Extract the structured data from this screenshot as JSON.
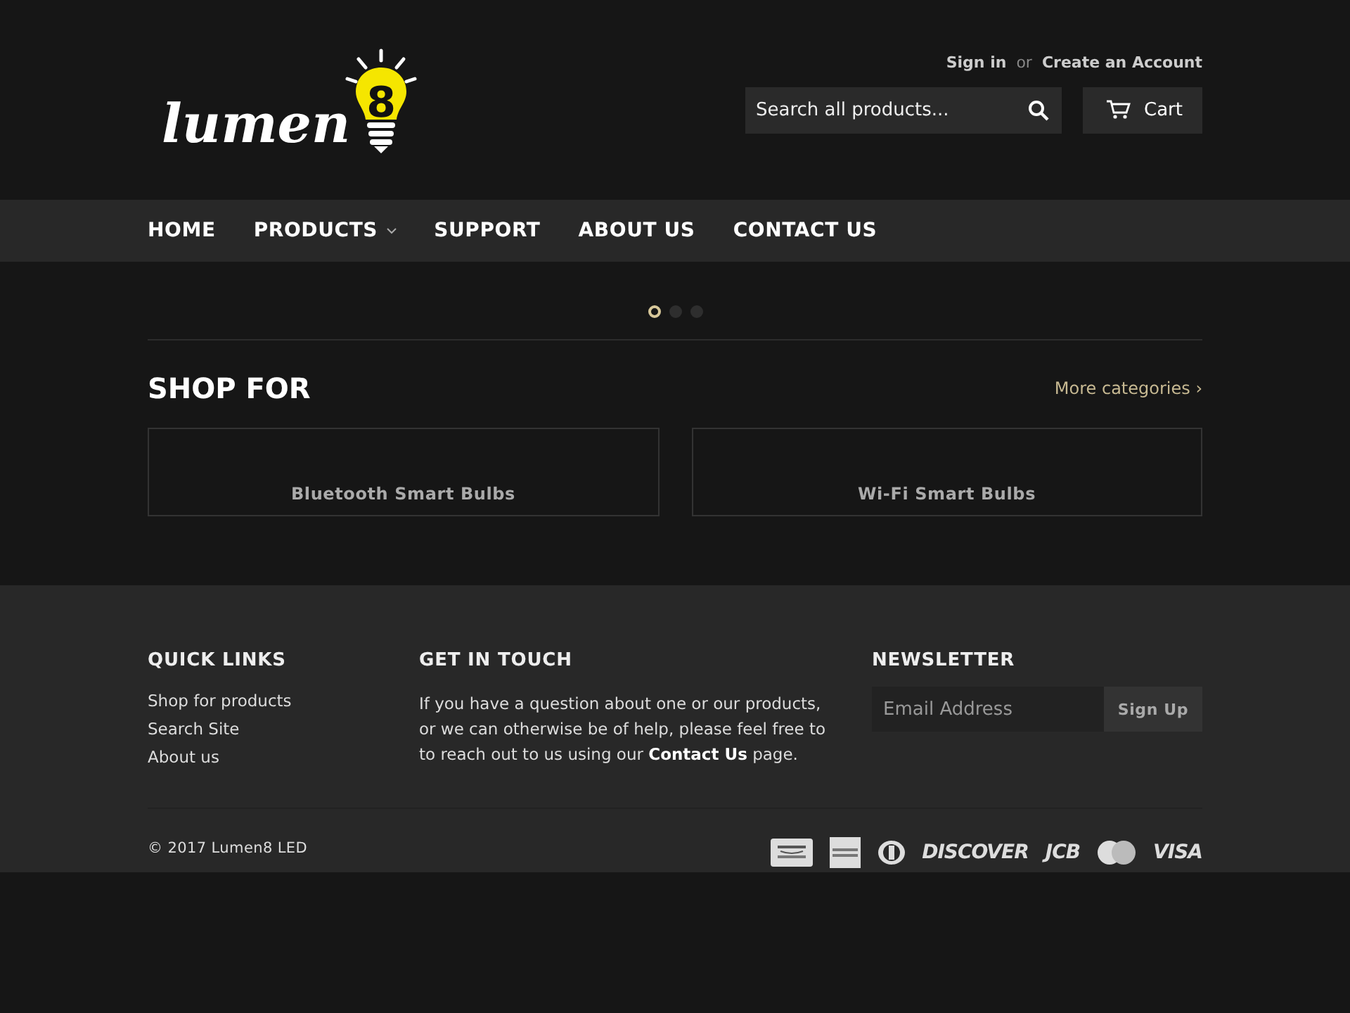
{
  "logo": {
    "text": "lumen",
    "digit": "8"
  },
  "account": {
    "sign_in": "Sign in",
    "separator": "or",
    "create": "Create an Account"
  },
  "search": {
    "placeholder": "Search all products..."
  },
  "cart": {
    "label": "Cart"
  },
  "nav": [
    {
      "label": "HOME",
      "has_dropdown": false
    },
    {
      "label": "PRODUCTS",
      "has_dropdown": true
    },
    {
      "label": "SUPPORT",
      "has_dropdown": false
    },
    {
      "label": "ABOUT US",
      "has_dropdown": false
    },
    {
      "label": "CONTACT US",
      "has_dropdown": false
    }
  ],
  "slider_dots": [
    {
      "selected": true
    },
    {
      "selected": false
    },
    {
      "selected": false
    }
  ],
  "shop_for": {
    "title": "SHOP FOR",
    "more_link": "More categories ›",
    "categories": [
      "Bluetooth Smart Bulbs",
      "Wi-Fi Smart Bulbs"
    ]
  },
  "footer": {
    "quick_links": {
      "title": "QUICK LINKS",
      "links": [
        "Shop for products",
        "Search Site",
        "About us"
      ]
    },
    "get_in_touch": {
      "title": "GET IN TOUCH",
      "text": "If you have a question about one or our products, or we can otherwise be of help, please feel free to to reach out to us using our **Contact Us** page."
    },
    "newsletter": {
      "title": "NEWSLETTER",
      "placeholder": "Email Address",
      "button": "Sign Up"
    },
    "copyright": "© 2017 Lumen8 LED",
    "payment_methods": [
      {
        "kind": "amazon"
      },
      {
        "kind": "amex"
      },
      {
        "kind": "diners"
      },
      {
        "kind": "wordmark",
        "label": "DISCOVER"
      },
      {
        "kind": "wordmark",
        "label": "JCB"
      },
      {
        "kind": "mastercard"
      },
      {
        "kind": "wordmark",
        "label": "VISA"
      }
    ]
  }
}
